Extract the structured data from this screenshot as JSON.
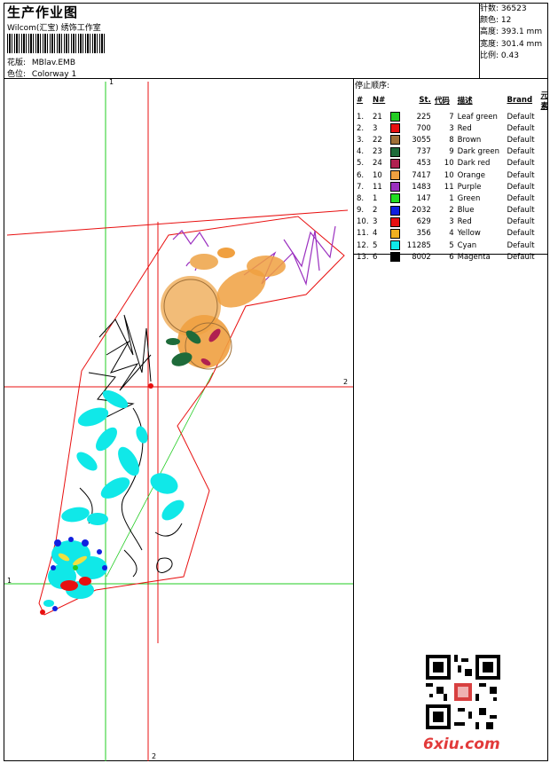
{
  "header": {
    "title": "生产作业图",
    "company": "Wilcom(汇宝) 绣饰工作室",
    "design_label": "花版:",
    "design_value": "MBlav.EMB",
    "colorway_label": "色位:",
    "colorway_value": "Colorway 1"
  },
  "stats": [
    {
      "label": "针数:",
      "value": "36523"
    },
    {
      "label": "颜色:",
      "value": "12"
    },
    {
      "label": "高度:",
      "value": "393.1 mm"
    },
    {
      "label": "宽度:",
      "value": "301.4 mm"
    },
    {
      "label": "比例:",
      "value": "0.43"
    }
  ],
  "stop_sequence": {
    "title": "停止顺序:",
    "headers": [
      "#",
      "N#",
      "St.",
      "代码",
      "描述",
      "Brand",
      "元素"
    ],
    "rows": [
      {
        "idx": "1.",
        "n": "21",
        "st": "225",
        "code": "7",
        "desc": "Leaf green",
        "brand": "Default",
        "color": "#22cc22"
      },
      {
        "idx": "2.",
        "n": "3",
        "st": "700",
        "code": "3",
        "desc": "Red",
        "brand": "Default",
        "color": "#e81010"
      },
      {
        "idx": "3.",
        "n": "22",
        "st": "3055",
        "code": "8",
        "desc": "Brown",
        "brand": "Default",
        "color": "#a07038"
      },
      {
        "idx": "4.",
        "n": "23",
        "st": "737",
        "code": "9",
        "desc": "Dark green",
        "brand": "Default",
        "color": "#1e6b3a"
      },
      {
        "idx": "5.",
        "n": "24",
        "st": "453",
        "code": "10",
        "desc": "Dark red",
        "brand": "Default",
        "color": "#b02050"
      },
      {
        "idx": "6.",
        "n": "10",
        "st": "7417",
        "code": "10",
        "desc": "Orange",
        "brand": "Default",
        "color": "#f0a040"
      },
      {
        "idx": "7.",
        "n": "11",
        "st": "1483",
        "code": "11",
        "desc": "Purple",
        "brand": "Default",
        "color": "#9b30c0"
      },
      {
        "idx": "8.",
        "n": "1",
        "st": "147",
        "code": "1",
        "desc": "Green",
        "brand": "Default",
        "color": "#22dd22"
      },
      {
        "idx": "9.",
        "n": "2",
        "st": "2032",
        "code": "2",
        "desc": "Blue",
        "brand": "Default",
        "color": "#1020e0"
      },
      {
        "idx": "10.",
        "n": "3",
        "st": "629",
        "code": "3",
        "desc": "Red",
        "brand": "Default",
        "color": "#e81010"
      },
      {
        "idx": "11.",
        "n": "4",
        "st": "356",
        "code": "4",
        "desc": "Yellow",
        "brand": "Default",
        "color": "#f0b020"
      },
      {
        "idx": "12.",
        "n": "5",
        "st": "11285",
        "code": "5",
        "desc": "Cyan",
        "brand": "Default",
        "color": "#10e8e8"
      },
      {
        "idx": "13.",
        "n": "6",
        "st": "8002",
        "code": "6",
        "desc": "Magenta",
        "brand": "Default",
        "color": "#000000"
      }
    ]
  },
  "axis_labels": {
    "v1": "1",
    "v2": "2",
    "h1": "1",
    "h2": "2"
  },
  "watermark": "6xiu.com"
}
